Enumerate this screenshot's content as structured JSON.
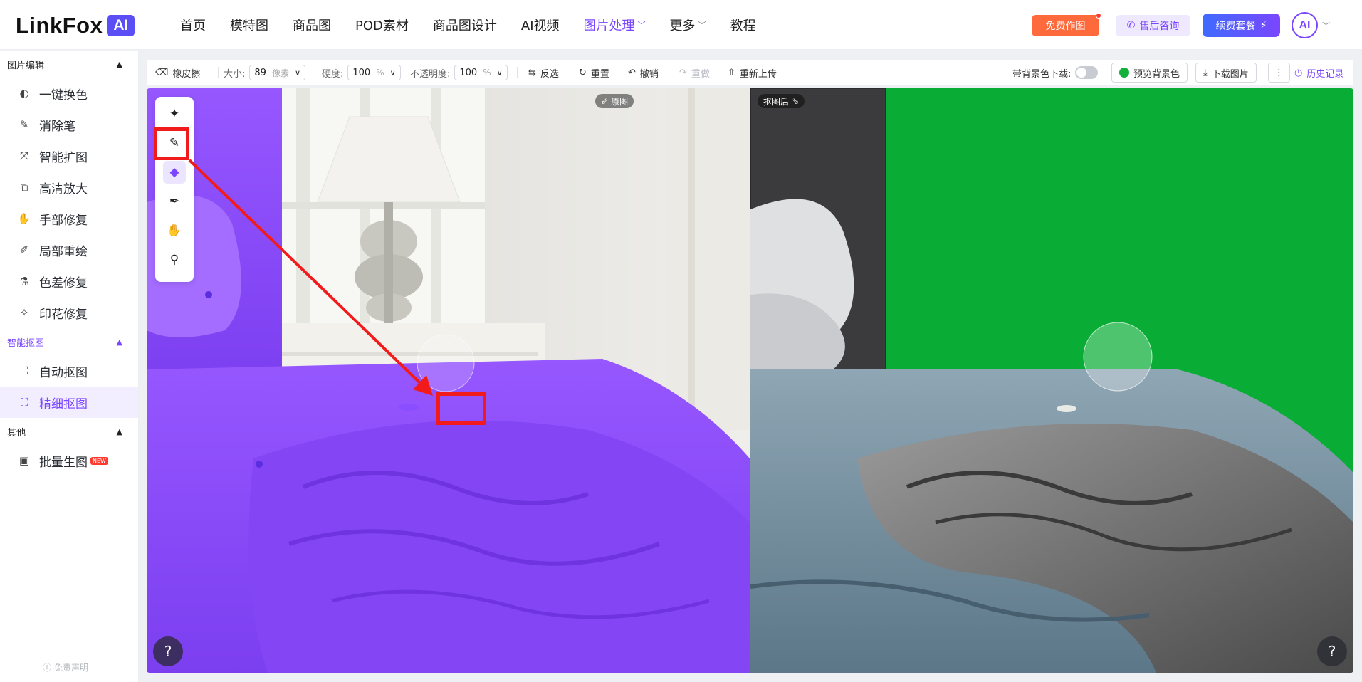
{
  "header": {
    "logo_text": "LinkFox",
    "logo_badge": "AI",
    "nav": [
      {
        "label": "首页"
      },
      {
        "label": "模特图"
      },
      {
        "label": "商品图"
      },
      {
        "label": "POD素材"
      },
      {
        "label": "商品图设计"
      },
      {
        "label": "AI视频"
      },
      {
        "label": "图片处理",
        "active": true,
        "has_dropdown": true
      },
      {
        "label": "更多",
        "has_dropdown": true
      },
      {
        "label": "教程"
      }
    ],
    "free_button": "免费作图",
    "service_button": "售后咨询",
    "renew_button": "续费套餐",
    "avatar_text": "AI"
  },
  "sidebar": {
    "sections": [
      {
        "title": "图片编辑",
        "items": [
          {
            "label": "一键换色",
            "icon": "palette-icon"
          },
          {
            "label": "消除笔",
            "icon": "eraser-pen-icon"
          },
          {
            "label": "智能扩图",
            "icon": "expand-icon"
          },
          {
            "label": "高清放大",
            "icon": "upscale-icon"
          },
          {
            "label": "手部修复",
            "icon": "hand-icon"
          },
          {
            "label": "局部重绘",
            "icon": "brush-icon"
          },
          {
            "label": "色差修复",
            "icon": "color-fix-icon"
          },
          {
            "label": "印花修复",
            "icon": "pattern-icon"
          }
        ]
      },
      {
        "title": "智能抠图",
        "items": [
          {
            "label": "自动抠图",
            "icon": "auto-cutout-icon"
          },
          {
            "label": "精细抠图",
            "icon": "fine-cutout-icon",
            "active": true
          }
        ]
      },
      {
        "title": "其他",
        "items": [
          {
            "label": "批量生图",
            "icon": "batch-image-icon",
            "badge": "NEW"
          }
        ]
      }
    ],
    "disclaimer": "免责声明"
  },
  "toolbar": {
    "current_tool": "橡皮擦",
    "size_label": "大小:",
    "size_value": "89",
    "size_unit": "像素",
    "hardness_label": "硬度:",
    "hardness_value": "100",
    "hardness_unit": "%",
    "opacity_label": "不透明度:",
    "opacity_value": "100",
    "opacity_unit": "%",
    "invert": "反选",
    "reset": "重置",
    "undo": "撤销",
    "redo": "重做",
    "reupload": "重新上传",
    "bg_download_label": "带背景色下载:",
    "bg_download_enabled": false,
    "preview_bg": "预览背景色",
    "preview_bg_color": "#13b03c",
    "download": "下载图片",
    "history": "历史记录"
  },
  "canvas": {
    "left_tag": "原图",
    "right_tag": "抠图后",
    "help_glyph": "?",
    "tools": [
      {
        "icon": "magic-wand-icon"
      },
      {
        "icon": "brush-icon"
      },
      {
        "icon": "eraser-icon",
        "active": true
      },
      {
        "icon": "pen-icon"
      },
      {
        "icon": "hand-pan-icon"
      },
      {
        "icon": "zoom-icon"
      }
    ],
    "colors": {
      "mask": "#8a4dff",
      "cutout_bg": "#09ad35",
      "annotation": "#f21b1b"
    }
  }
}
